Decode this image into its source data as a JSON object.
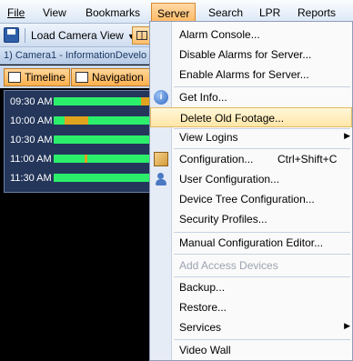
{
  "menubar": {
    "items": [
      {
        "label": "File",
        "underline_index": 0
      },
      {
        "label": "View",
        "underline_index": 0
      },
      {
        "label": "Bookmarks",
        "underline_index": 0
      },
      {
        "label": "Server",
        "underline_index": 0
      },
      {
        "label": "Search",
        "underline_index": 0
      },
      {
        "label": "LPR",
        "underline_index": 0
      },
      {
        "label": "Reports",
        "underline_index": 0
      }
    ],
    "active": "Server"
  },
  "toolbar": {
    "load_camera_view_label": "Load Camera View"
  },
  "camera_panel": {
    "title": "1) Camera1 - InformationDevelo",
    "tabs": [
      {
        "label": "Timeline"
      },
      {
        "label": "Navigation"
      }
    ],
    "timeline_rows": [
      {
        "time": "09:30 AM"
      },
      {
        "time": "10:00 AM"
      },
      {
        "time": "10:30 AM"
      },
      {
        "time": "11:00 AM"
      },
      {
        "time": "11:30 AM"
      }
    ]
  },
  "server_menu": {
    "items": [
      {
        "label": "Alarm Console...",
        "enabled": true
      },
      {
        "label": "Disable Alarms for Server...",
        "enabled": true
      },
      {
        "label": "Enable Alarms for Server...",
        "enabled": true
      },
      {
        "label": "Get Info...",
        "enabled": true,
        "icon": "info-icon"
      },
      {
        "label": "Delete Old Footage...",
        "enabled": true,
        "highlighted": true
      },
      {
        "label": "View Logins",
        "enabled": true,
        "submenu": true
      },
      {
        "label": "Configuration...",
        "enabled": true,
        "shortcut": "Ctrl+Shift+C",
        "icon": "config-icon"
      },
      {
        "label": "User Configuration...",
        "enabled": true,
        "icon": "user-icon"
      },
      {
        "label": "Device Tree Configuration...",
        "enabled": true
      },
      {
        "label": "Security Profiles...",
        "enabled": true
      },
      {
        "label": "Manual Configuration Editor...",
        "enabled": true
      },
      {
        "label": "Add Access Devices",
        "enabled": false
      },
      {
        "label": "Backup...",
        "enabled": true
      },
      {
        "label": "Restore...",
        "enabled": true
      },
      {
        "label": "Services",
        "enabled": true,
        "submenu": true
      },
      {
        "label": "Video Wall",
        "enabled": true
      }
    ]
  },
  "colors": {
    "recorded": "#2bef6b",
    "motion": "#e0a31d",
    "menu_highlight": "#ffe6a7",
    "timeline_bg": "#24365a"
  }
}
